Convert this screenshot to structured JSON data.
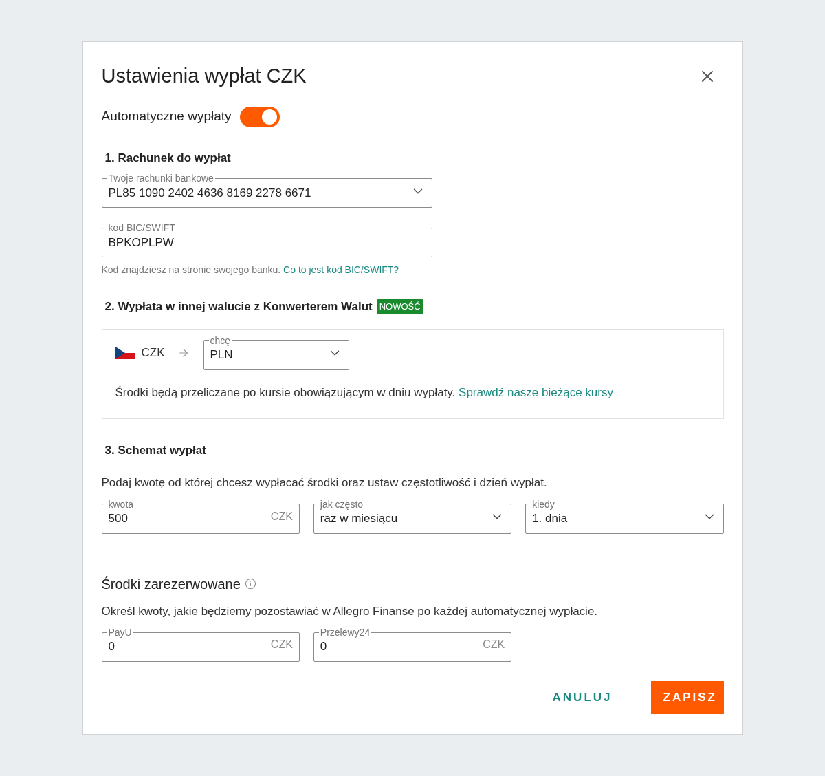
{
  "dialog": {
    "title": "Ustawienia wypłat CZK"
  },
  "auto_payout": {
    "label": "Automatyczne wypłaty",
    "on": true
  },
  "account_section": {
    "heading": "1. Rachunek do wypłat",
    "account": {
      "label": "Twoje rachunki bankowe",
      "value": "PL85 1090 2402 4636 8169 2278 6671"
    },
    "bic": {
      "label": "kod BIC/SWIFT",
      "value": "BPKOPLPW"
    },
    "hint": "Kod znajdziesz na stronie swojego banku.",
    "hint_link": "Co to jest kod BIC/SWIFT?"
  },
  "currency_section": {
    "heading": "2. Wypłata w innej walucie z Konwerterem Walut",
    "badge": "NOWOŚĆ",
    "from_currency": "CZK",
    "target": {
      "label": "chcę",
      "value": "PLN"
    },
    "note": "Środki będą przeliczane po kursie obowiązującym w dniu wypłaty.",
    "note_link": "Sprawdź nasze bieżące kursy"
  },
  "schedule_section": {
    "heading": "3. Schemat wypłat",
    "description": "Podaj kwotę od której chcesz wypłacać środki oraz ustaw częstotliwość i dzień wypłat.",
    "fields": [
      {
        "kind": "input",
        "label": "kwota",
        "value": "500",
        "suffix": "CZK"
      },
      {
        "kind": "select",
        "label": "jak często",
        "value": "raz w miesiącu"
      },
      {
        "kind": "select",
        "label": "kiedy",
        "value": "1. dnia"
      }
    ]
  },
  "reserved_section": {
    "heading": "Środki zarezerwowane",
    "description": "Określ kwoty, jakie będziemy pozostawiać w Allegro Finanse po każdej automatycznej wypłacie.",
    "fields": [
      {
        "kind": "input",
        "label": "PayU",
        "value": "0",
        "suffix": "CZK"
      },
      {
        "kind": "input",
        "label": "Przelewy24",
        "value": "0",
        "suffix": "CZK"
      }
    ]
  },
  "buttons": [
    {
      "kind": "secondary",
      "label": "ANULUJ"
    },
    {
      "kind": "primary",
      "label": "ZAPISZ"
    }
  ]
}
